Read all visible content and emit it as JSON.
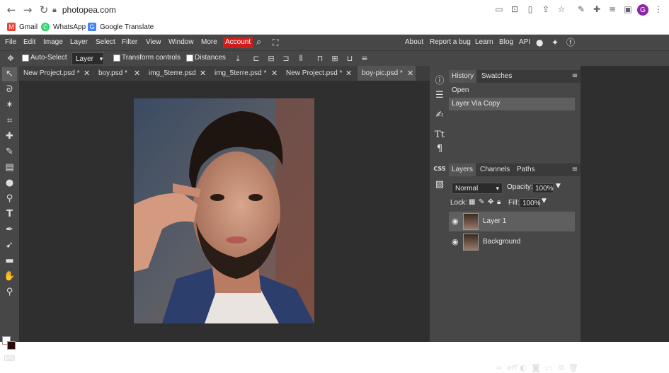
{
  "browser": {
    "url": "photopea.com",
    "back_icon": "arrow-left-icon",
    "forward_icon": "arrow-right-icon",
    "reload_icon": "reload-icon",
    "avatar_letter": "G"
  },
  "bookmarks": [
    {
      "label": "Gmail",
      "icon": "gmail-icon"
    },
    {
      "label": "WhatsApp",
      "icon": "whatsapp-icon"
    },
    {
      "label": "Google Translate",
      "icon": "translate-icon"
    }
  ],
  "menu": {
    "items": [
      "File",
      "Edit",
      "Image",
      "Layer",
      "Select",
      "Filter",
      "View",
      "Window",
      "More",
      "Account"
    ],
    "right": [
      "About",
      "Report a bug",
      "Learn",
      "Blog",
      "API"
    ]
  },
  "options": {
    "auto_select": "Auto-Select",
    "layer_mode": "Layer",
    "transform_controls": "Transform controls",
    "distances": "Distances"
  },
  "tabs": [
    {
      "label": "New Project.psd *"
    },
    {
      "label": "boy.psd *"
    },
    {
      "label": "img_5terre.psd"
    },
    {
      "label": "img_5terre.psd *"
    },
    {
      "label": "New Project.psd *"
    },
    {
      "label": "boy-pic.psd *",
      "active": true
    }
  ],
  "history": {
    "tabs": [
      "History",
      "Swatches"
    ],
    "items": [
      "Open",
      "Layer Via Copy"
    ]
  },
  "layers": {
    "tabs": [
      "Layers",
      "Channels",
      "Paths"
    ],
    "blend_mode": "Normal",
    "opacity_label": "Opacity:",
    "opacity": "100%",
    "lock_label": "Lock:",
    "fill_label": "Fill:",
    "fill": "100%",
    "items": [
      "Layer 1",
      "Background"
    ]
  },
  "side": {
    "css_label": "CSS"
  },
  "colors": {
    "accent": "#d21c1c",
    "panel": "#474747",
    "workspace": "#2f2f2f"
  }
}
